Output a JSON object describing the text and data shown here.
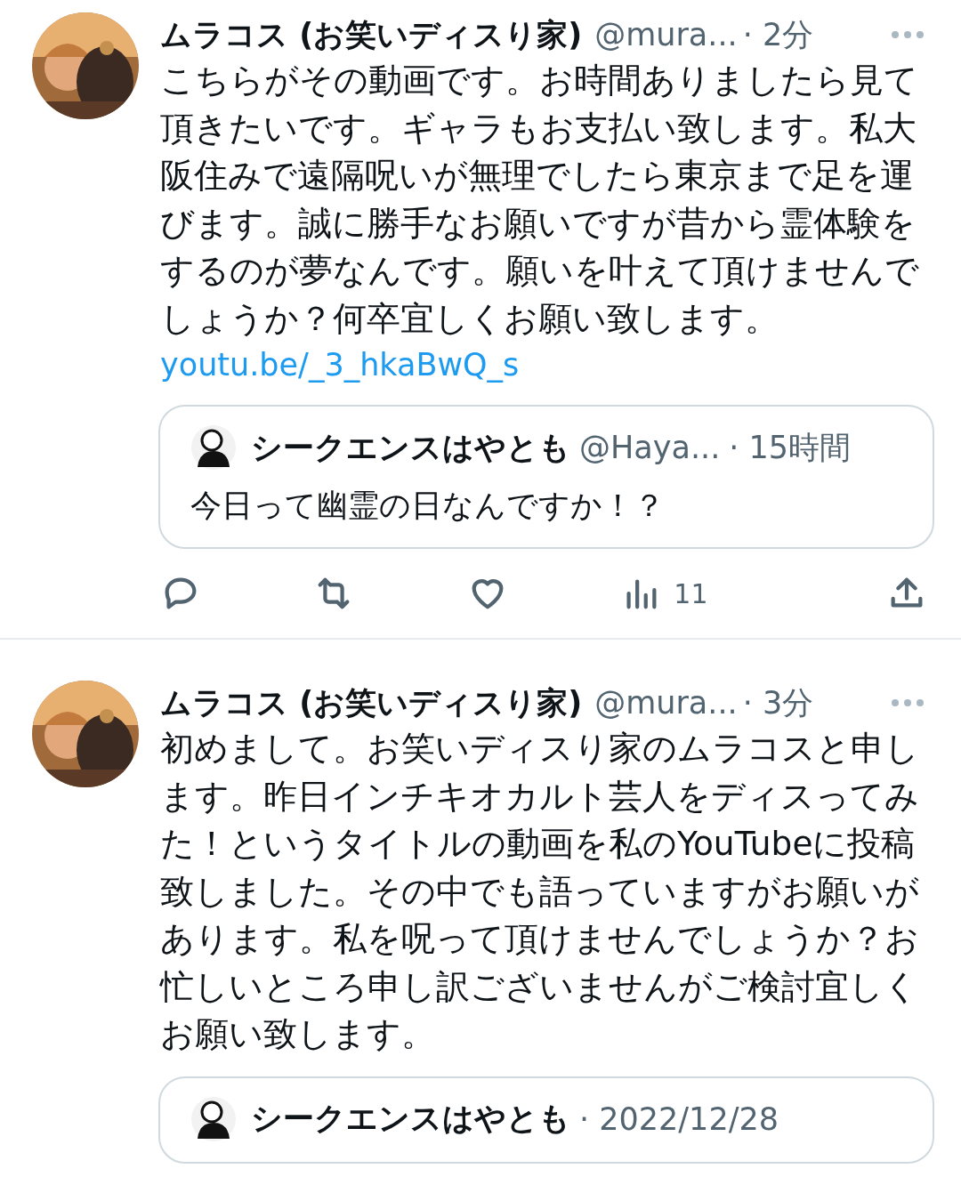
{
  "tweets": [
    {
      "author": "ムラコス (お笑いディスり家)",
      "handle": "@mura...",
      "time": "· 2分",
      "text": "こちらがその動画です。お時間ありましたら見て頂きたいです。ギャラもお支払い致します。私大阪住みで遠隔呪いが無理でしたら東京まで足を運びます。誠に勝手なお願いですが昔から霊体験をするのが夢なんです。願いを叶えて頂けませんでしょうか？何卒宜しくお願い致します。",
      "link": "youtu.be/_3_hkaBwQ_s",
      "quote": {
        "author": "シークエンスはやとも",
        "handle": "@Haya...",
        "time": "· 15時間",
        "text": "今日って幽霊の日なんですか！？"
      },
      "actions": {
        "views": "11"
      }
    },
    {
      "author": "ムラコス (お笑いディスり家)",
      "handle": "@mura...",
      "time": "· 3分",
      "text": "初めまして。お笑いディスり家のムラコスと申します。昨日インチキオカルト芸人をディスってみた！というタイトルの動画を私のYouTubeに投稿致しました。その中でも語っていますがお願いがあります。私を呪って頂けませんでしょうか？お忙しいところ申し訳ございませんがご検討宜しくお願い致します。",
      "quote": {
        "author": "シークエンスはやとも",
        "time": "· 2022/12/28"
      }
    }
  ]
}
